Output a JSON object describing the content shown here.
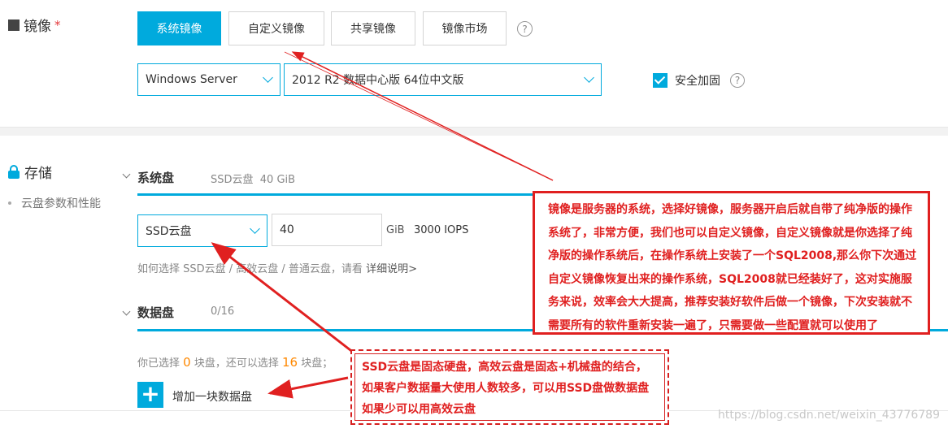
{
  "image_section": {
    "title": "镜像",
    "required_mark": "*",
    "tabs": [
      {
        "label": "系统镜像",
        "active": true
      },
      {
        "label": "自定义镜像",
        "active": false
      },
      {
        "label": "共享镜像",
        "active": false
      },
      {
        "label": "镜像市场",
        "active": false
      }
    ],
    "help_glyph": "?",
    "os_type": "Windows Server",
    "os_version": "2012 R2 数据中心版 64位中文版",
    "security_label": "安全加固",
    "security_checked": true
  },
  "storage_section": {
    "title": "存储",
    "side_link": "云盘参数和性能",
    "system_disk": {
      "title": "系统盘",
      "summary": "SSD云盘  40 GiB",
      "type_value": "SSD云盘",
      "size_value": "40",
      "unit": "GiB",
      "iops": "3000 IOPS",
      "help_text": "如何选择 SSD云盘 / 高效云盘 / 普通云盘，请看",
      "help_link": "详细说明>"
    },
    "data_disk": {
      "title": "数据盘",
      "count": "0/16",
      "selected_prefix": "你已选择",
      "selected_count": "0",
      "selected_mid": "块盘，还可以选择",
      "remaining_count": "16",
      "selected_suffix": "块盘；",
      "add_label": "增加一块数据盘"
    }
  },
  "annotations": {
    "note1_lines": [
      "镜像是服务器的系统，选择好镜像，服务器开启后就自带了纯净版的操作",
      "系统了，非常方便，我们也可以自定义镜像，自定义镜像就是你选择了纯",
      "净版的操作系统后，在操作系统上安装了一个SQL2008,那么你下次通过",
      "自定义镜像恢复出来的操作系统，SQL2008就已经装好了，这对实施服",
      "务来说，效率会大大提高，推荐安装好软件后做一个镜像，下次安装就不",
      "需要所有的软件重新安装一遍了，只需要做一些配置就可以使用了"
    ],
    "note2_lines": [
      "SSD云盘是固态硬盘，高效云盘是固态+机械盘的结合，",
      "如果客户数据量大使用人数较多，可以用SSD盘做数据盘",
      "如果少可以用高效云盘"
    ]
  },
  "watermark": "https://blog.csdn.net/weixin_43776789",
  "colors": {
    "accent": "#00aadd",
    "annotation_red": "#e02020",
    "highlight_orange": "#ff8800"
  }
}
